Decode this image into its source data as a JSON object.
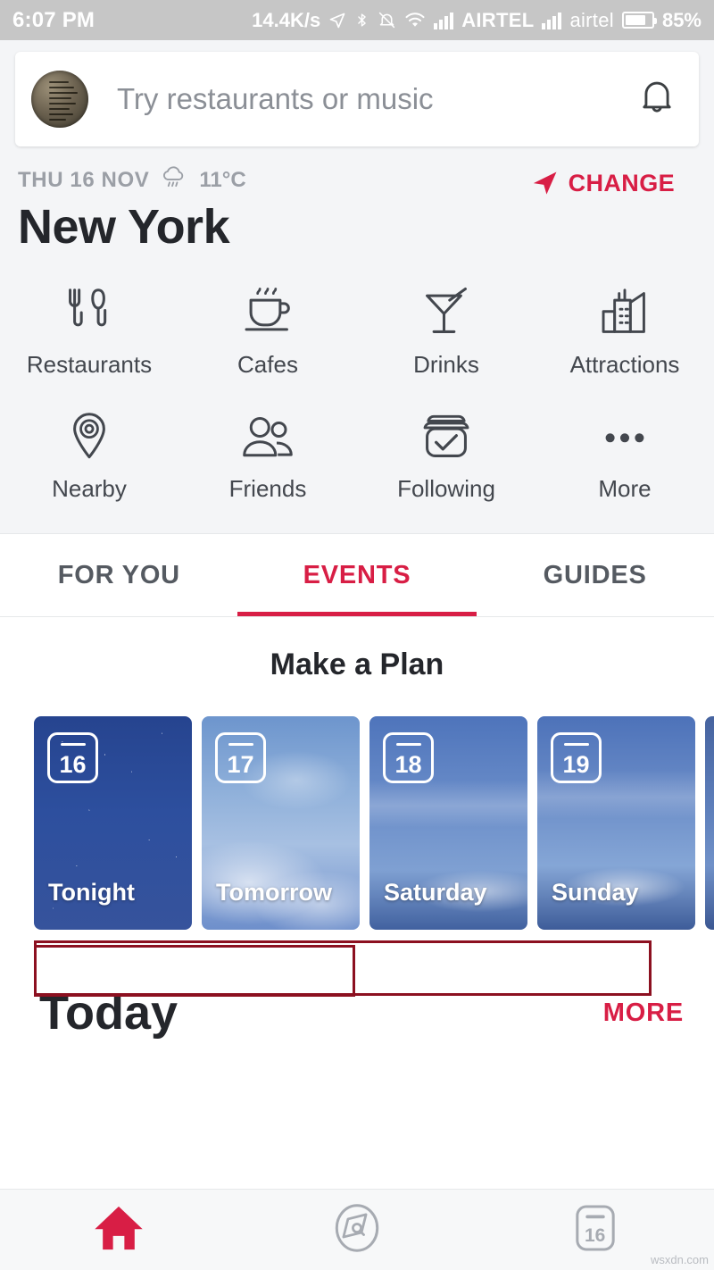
{
  "statusbar": {
    "time": "6:07 PM",
    "network_speed": "14.4K/s",
    "carrier_1": "AIRTEL",
    "carrier_2": "airtel",
    "battery": "85%",
    "icons": [
      "location-arrow-icon",
      "bluetooth-icon",
      "bell-muted-icon",
      "wifi-icon",
      "signal-bars-icon",
      "battery-icon"
    ]
  },
  "search": {
    "placeholder": "Try restaurants or music",
    "value": "",
    "avatar_name": "user-avatar",
    "bell_name": "notification-bell-icon"
  },
  "location": {
    "date": "THU 16 NOV",
    "temperature": "11°C",
    "weather_icon": "rain-cloud-icon",
    "city": "New York",
    "change_label": "CHANGE",
    "change_icon": "navigation-arrow-icon"
  },
  "categories": [
    {
      "label": "Restaurants",
      "icon": "cutlery-icon"
    },
    {
      "label": "Cafes",
      "icon": "coffee-cup-icon"
    },
    {
      "label": "Drinks",
      "icon": "cocktail-glass-icon"
    },
    {
      "label": "Attractions",
      "icon": "buildings-icon"
    },
    {
      "label": "Nearby",
      "icon": "map-pin-target-icon"
    },
    {
      "label": "Friends",
      "icon": "people-icon"
    },
    {
      "label": "Following",
      "icon": "card-check-icon"
    },
    {
      "label": "More",
      "icon": "ellipsis-icon"
    }
  ],
  "tabs": [
    {
      "label": "FOR YOU",
      "active": false
    },
    {
      "label": "EVENTS",
      "active": true
    },
    {
      "label": "GUIDES",
      "active": false
    }
  ],
  "make_a_plan": {
    "title": "Make a Plan",
    "cards": [
      {
        "date": "16",
        "label": "Tonight"
      },
      {
        "date": "17",
        "label": "Tomorrow"
      },
      {
        "date": "18",
        "label": "Saturday"
      },
      {
        "date": "19",
        "label": "Sunday"
      },
      {
        "date": "",
        "label": ""
      }
    ]
  },
  "today": {
    "title": "Today",
    "more_label": "MORE"
  },
  "bottom_nav": [
    {
      "icon": "home-icon",
      "active": true
    },
    {
      "icon": "explore-icon",
      "active": false
    },
    {
      "icon": "calendar-icon",
      "active": false,
      "day": "16"
    }
  ],
  "watermark": "wsxdn.com",
  "colors": {
    "accent": "#d81e45",
    "annotation": "#8c1020",
    "page_bg": "#f4f5f7",
    "statusbar_bg": "#c6c6c6",
    "text_dark": "#24262b",
    "text_muted": "#9b9fa6"
  }
}
